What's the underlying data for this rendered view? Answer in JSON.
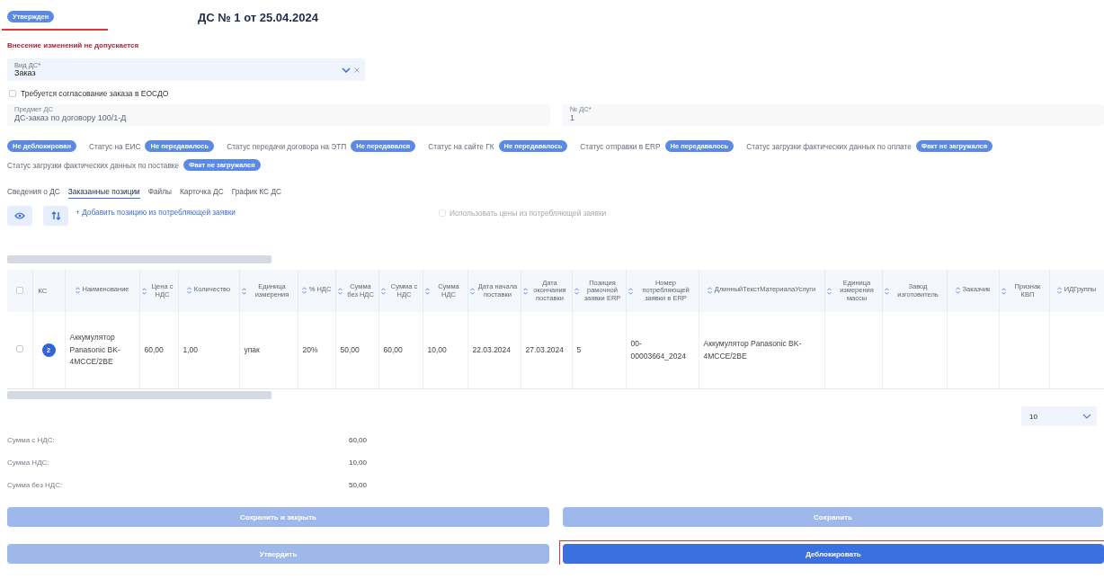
{
  "header": {
    "status_badge": {
      "label": "Утвержден",
      "highlighted": true
    },
    "title": "ДС № 1 от 25.04.2024"
  },
  "warning": "Внесение изменений не допускается",
  "kind_select": {
    "label": "Вид ДС*",
    "value": "Заказ"
  },
  "approval_checkbox": {
    "label": "Требуется согласование заказа в ЕОСДО",
    "checked": false
  },
  "fields": [
    {
      "label": "Предмет ДС",
      "value": "ДС-заказ по договору 100/1-Д",
      "disabled": true
    },
    {
      "label": "№ ДС*",
      "value": "1",
      "disabled": true
    }
  ],
  "statuses": [
    {
      "badge": "Не деблокирован"
    },
    {
      "label": "Статус на ЕИС",
      "badge": "Не передавалось"
    },
    {
      "label": "Статус передачи договора на ЭТП",
      "badge": "Не передавался"
    },
    {
      "label": "Статус на сайте ГК",
      "badge": "Не передавалось"
    },
    {
      "label": "Статус отправки в ERP",
      "badge": "Не передавалось"
    },
    {
      "label": "Статус загрузки фактических данных по оплате",
      "badge": "Факт не загружался"
    },
    {
      "label": "Статус загрузки фактических данных по поставке",
      "badge": "Факт не загружался"
    }
  ],
  "tabs": [
    {
      "label": "Сведения о ДС",
      "selected": false
    },
    {
      "label": "Заказанные позиции",
      "selected": true
    },
    {
      "label": "Файлы",
      "selected": false
    },
    {
      "label": "Карточка ДС",
      "selected": false
    },
    {
      "label": "График КС ДС",
      "selected": false
    }
  ],
  "toolbar": {
    "add_link": "+ Добавить позицию из потребляющей заявки",
    "use_prices": {
      "label": "Использовать цены из потребляющей заявки",
      "checked": false,
      "disabled": true
    }
  },
  "table": {
    "header_checked": false,
    "columns": [
      {
        "label": "КС",
        "sortable": false
      },
      {
        "label": "Наименование",
        "sortable": true
      },
      {
        "label": "Цена с НДС",
        "sortable": true
      },
      {
        "label": "Количество",
        "sortable": true
      },
      {
        "label": "Единица измерения",
        "sortable": true
      },
      {
        "label": "% НДС",
        "sortable": true
      },
      {
        "label": "Сумма без НДС",
        "sortable": true
      },
      {
        "label": "Сумма с НДС",
        "sortable": true
      },
      {
        "label": "Сумма НДС",
        "sortable": true
      },
      {
        "label": "Дата начала поставки",
        "sortable": true
      },
      {
        "label": "Дата окончания поставки",
        "sortable": true
      },
      {
        "label": "Позиция рамочной заявки ERP",
        "sortable": true
      },
      {
        "label": "Номер потребляющей заявки в ERP",
        "sortable": true
      },
      {
        "label": "ДлинныйТекстМатериалаУслуги",
        "sortable": true
      },
      {
        "label": "Единица измерения массы",
        "sortable": true
      },
      {
        "label": "Завод изготовитель",
        "sortable": true
      },
      {
        "label": "Заказчик",
        "sortable": true
      },
      {
        "label": "Признак КВП",
        "sortable": true
      },
      {
        "label": "ИДГруппы",
        "sortable": true
      }
    ],
    "rows": [
      {
        "checked": false,
        "cells": [
          "2",
          "Аккумулятор Panasonic BK-4MCCE/2BE",
          "60,00",
          "1,00",
          "упак",
          "20%",
          "50,00",
          "60,00",
          "10,00",
          "22.03.2024",
          "27.03.2024",
          "5",
          "00-00003664_2024",
          "Аккумулятор Panasonic BK-4MCCE/2BE",
          "",
          "",
          "",
          "",
          ""
        ]
      }
    ]
  },
  "page_size": "10",
  "totals": [
    {
      "label": "Сумма с НДС:",
      "value": "60,00"
    },
    {
      "label": "Сумма НДС:",
      "value": "10,00"
    },
    {
      "label": "Сумма без НДС:",
      "value": "50,00"
    }
  ],
  "buttons": [
    {
      "label": "Сохранить и закрыть",
      "disabled": true,
      "highlighted": false
    },
    {
      "label": "Сохранить",
      "disabled": true,
      "highlighted": false
    },
    {
      "label": "Утвердить",
      "disabled": true,
      "highlighted": false
    },
    {
      "label": "Деблокировать",
      "disabled": false,
      "highlighted": true
    }
  ]
}
